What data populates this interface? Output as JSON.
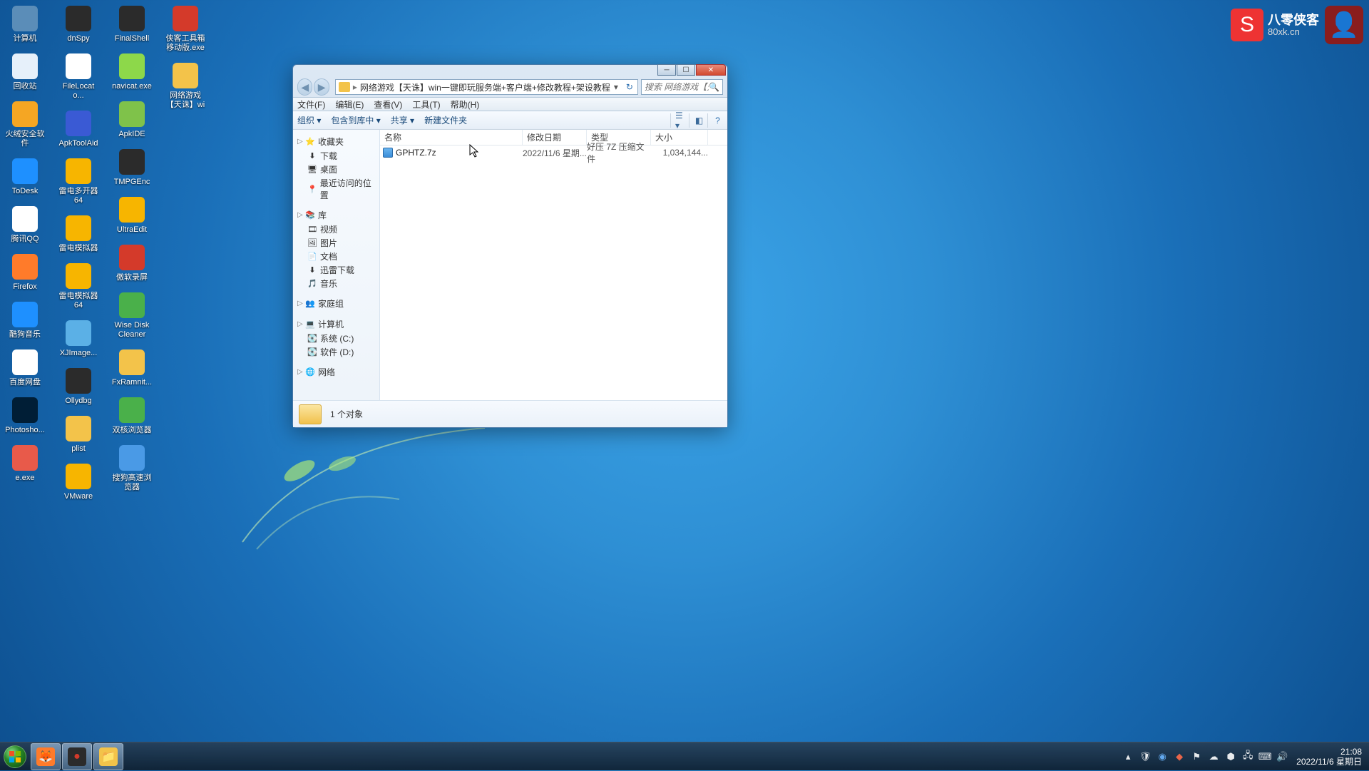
{
  "watermark": {
    "title": "八零侠客",
    "sub": "80xk.cn"
  },
  "desktop": {
    "icons": [
      {
        "label": "计算机",
        "color": "#5b8db8"
      },
      {
        "label": "dnSpy",
        "color": "#2b2b2b"
      },
      {
        "label": "FinalShell",
        "color": "#2b2b2b"
      },
      {
        "label": "侠客工具箱移动版.exe",
        "color": "#d43a2a"
      },
      {
        "label": "回收站",
        "color": "#e6f0fa"
      },
      {
        "label": "FileLocato...",
        "color": "#fff"
      },
      {
        "label": "navicat.exe",
        "color": "#8dd84a"
      },
      {
        "label": "网络游戏【天诛】win一...",
        "color": "#f3c34a"
      },
      {
        "label": "火绒安全软件",
        "color": "#f5a623"
      },
      {
        "label": "ApkToolAid",
        "color": "#3a5ad4"
      },
      {
        "label": "ApkIDE",
        "color": "#7fc24a"
      },
      {
        "label": "ToDesk",
        "color": "#1e90ff"
      },
      {
        "label": "雷电多开器64",
        "color": "#f7b500"
      },
      {
        "label": "TMPGEnc",
        "color": "#2b2b2b"
      },
      {
        "label": "腾讯QQ",
        "color": "#fff"
      },
      {
        "label": "雷电模拟器",
        "color": "#f7b500"
      },
      {
        "label": "UltraEdit",
        "color": "#f7b500"
      },
      {
        "label": "Firefox",
        "color": "#ff7b2a"
      },
      {
        "label": "雷电模拟器64",
        "color": "#f7b500"
      },
      {
        "label": "傲软录屏",
        "color": "#d43a2a"
      },
      {
        "label": "酷狗音乐",
        "color": "#1e90ff"
      },
      {
        "label": "XJImage...",
        "color": "#5bb0e6"
      },
      {
        "label": "Wise Disk Cleaner",
        "color": "#4ab04a"
      },
      {
        "label": "百度网盘",
        "color": "#fff"
      },
      {
        "label": "Ollydbg",
        "color": "#2b2b2b"
      },
      {
        "label": "FxRamnit...",
        "color": "#f3c34a"
      },
      {
        "label": "Photosho...",
        "color": "#001e36"
      },
      {
        "label": "plist",
        "color": "#f3c34a"
      },
      {
        "label": "双核浏览器",
        "color": "#4ab04a"
      },
      {
        "label": "e.exe",
        "color": "#e85a4a"
      },
      {
        "label": "VMware",
        "color": "#f7b500"
      },
      {
        "label": "搜狗高速浏览器",
        "color": "#4a9ae6"
      }
    ]
  },
  "explorer": {
    "path": "网络游戏【天诛】win一键即玩服务端+客户端+修改教程+架设教程",
    "search_placeholder": "搜索 网络游戏【天诛】win...",
    "menu": [
      "文件(F)",
      "编辑(E)",
      "查看(V)",
      "工具(T)",
      "帮助(H)"
    ],
    "toolbar": {
      "organize": "组织 ▾",
      "include": "包含到库中 ▾",
      "share": "共享 ▾",
      "new_folder": "新建文件夹"
    },
    "columns": {
      "name": "名称",
      "date": "修改日期",
      "type": "类型",
      "size": "大小"
    },
    "sidebar": {
      "favorites": {
        "head": "收藏夹",
        "items": [
          "下载",
          "桌面",
          "最近访问的位置"
        ]
      },
      "libraries": {
        "head": "库",
        "items": [
          "视频",
          "图片",
          "文档",
          "迅雷下载",
          "音乐"
        ]
      },
      "homegroup": {
        "head": "家庭组"
      },
      "computer": {
        "head": "计算机",
        "items": [
          "系统 (C:)",
          "软件 (D:)"
        ]
      },
      "network": {
        "head": "网络"
      }
    },
    "files": [
      {
        "name": "GPHTZ.7z",
        "date": "2022/11/6 星期...",
        "type": "好压 7Z 压缩文件",
        "size": "1,034,144..."
      }
    ],
    "status": "1 个对象"
  },
  "taskbar": {
    "apps": [
      {
        "name": "firefox",
        "color": "#ff7b2a",
        "glyph": "🦊"
      },
      {
        "name": "recorder",
        "color": "#2b2b2b",
        "glyph": "●",
        "glyph_color": "#d43a2a"
      },
      {
        "name": "explorer",
        "color": "#f3c34a",
        "glyph": "📁"
      }
    ],
    "clock": {
      "time": "21:08",
      "date": "2022/11/6 星期日"
    }
  }
}
